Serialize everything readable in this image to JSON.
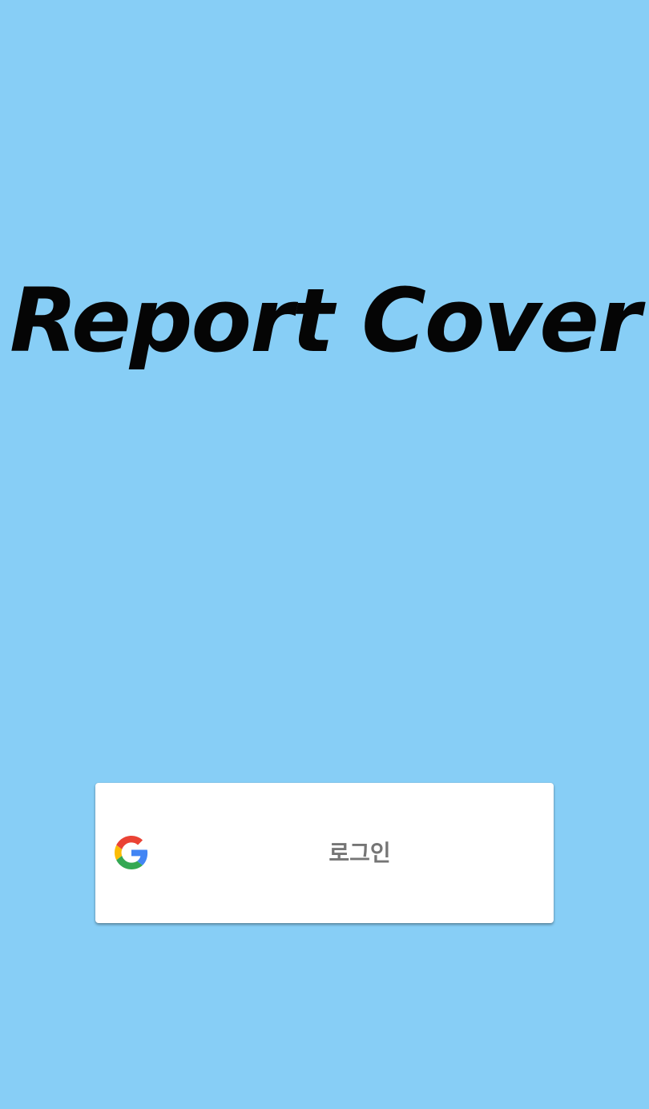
{
  "app": {
    "title": "Report Cover",
    "background_color": "#87CEF6"
  },
  "login_button": {
    "label": "로그인",
    "icon": "google-g-icon",
    "background_color": "#FFFFFF",
    "text_color": "#757575"
  }
}
